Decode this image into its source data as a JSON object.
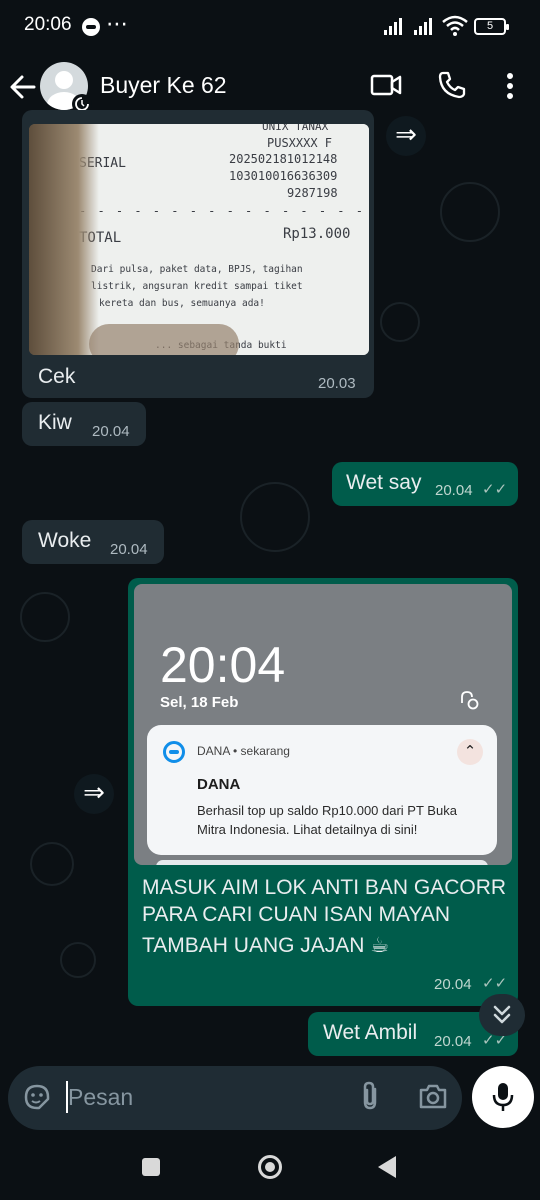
{
  "status_bar": {
    "time": "20:06",
    "battery": "5"
  },
  "header": {
    "contact_name": "Buyer Ke 62"
  },
  "receipt": {
    "lines": [
      "UNIX TANAX",
      "PUSXXXX F"
    ],
    "serial_label": "SERIAL",
    "serial_values": [
      "202502181012148",
      "103010016636309",
      "9287198"
    ],
    "total_label": "TOTAL",
    "total_value": "Rp13.000",
    "footer": [
      "Dari pulsa, paket data, BPJS, tagihan",
      "listrik, angsuran kredit sampai tiket",
      "kereta dan bus, semuanya ada!"
    ],
    "footer2": "... sebagai tanda bukti"
  },
  "messages": [
    {
      "id": "m1",
      "text": "Cek",
      "time": "20.03",
      "direction": "in"
    },
    {
      "id": "m2",
      "text": "Kiw",
      "time": "20.04",
      "direction": "in"
    },
    {
      "id": "m3",
      "text": "Wet say",
      "time": "20.04",
      "direction": "out"
    },
    {
      "id": "m4",
      "text": "Woke",
      "time": "20.04",
      "direction": "in"
    },
    {
      "id": "m5",
      "text_lines": [
        "MASUK AIM LOK ANTI BAN GACORR",
        "PARA CARI CUAN ISAN MAYAN",
        "TAMBAH UANG JAJAN ☕"
      ],
      "time": "20.04",
      "direction": "out"
    },
    {
      "id": "m6",
      "text": "Wet Ambil",
      "time": "20.04",
      "direction": "out"
    }
  ],
  "dana_screenshot": {
    "lock_time": "20:04",
    "lock_date": "Sel, 18 Feb",
    "notification": {
      "app": "DANA • sekarang",
      "title": "DANA",
      "body": "Berhasil top up saldo Rp10.000 dari PT Buka Mitra Indonesia. Lihat detailnya di sini!"
    }
  },
  "input": {
    "placeholder": "Pesan"
  },
  "icons": {
    "back": "back-arrow-icon",
    "video": "video-call-icon",
    "call": "phone-icon",
    "menu": "more-vert-icon",
    "forward": "forward-icon",
    "sticker": "sticker-icon",
    "attach": "paperclip-icon",
    "camera": "camera-icon",
    "mic": "mic-icon",
    "scroll": "double-chevron-down-icon",
    "ticks": "double-check-icon"
  },
  "colors": {
    "incoming_bubble": "#202c33",
    "outgoing_bubble": "#005c4b",
    "background": "#0b1014"
  }
}
